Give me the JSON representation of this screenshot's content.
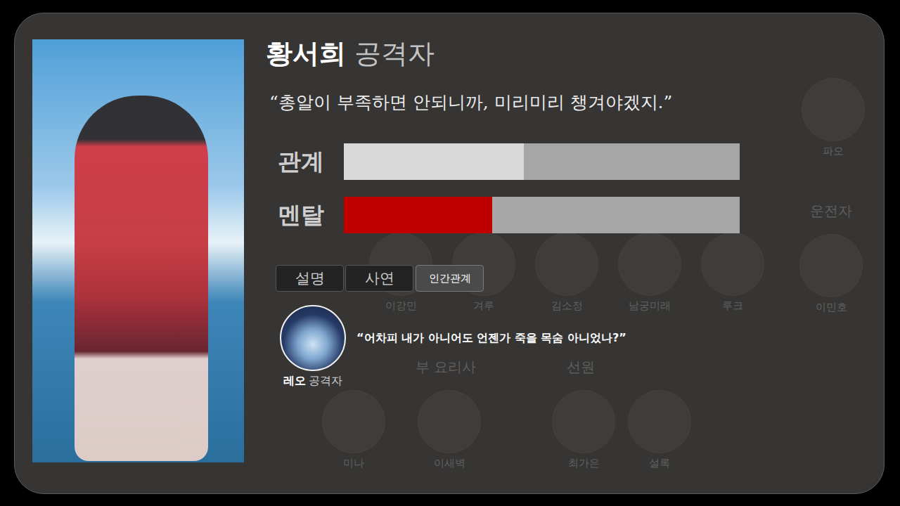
{
  "character": {
    "name": "황서희",
    "role": "공격자",
    "quote": "“총알이 부족하면 안되니까, 미리미리 챙겨야겠지.”"
  },
  "stats": [
    {
      "label": "관계",
      "level": 0.455,
      "color": "#d9d9d9"
    },
    {
      "label": "멘탈",
      "level": 0.375,
      "color": "#c00000"
    }
  ],
  "tabs": [
    {
      "label": "설명",
      "selected": false
    },
    {
      "label": "사연",
      "selected": false
    },
    {
      "label": "인간관계",
      "selected": true
    }
  ],
  "relations": [
    {
      "name": "레오",
      "role": "공격자",
      "quote": "“어차피 내가 아니어도 언젠가 죽을 목숨 아니었나?”"
    }
  ],
  "roster": [
    {
      "members": [
        "파오"
      ]
    },
    {
      "header": "운전자",
      "members": [
        "이민호"
      ]
    },
    {
      "members": [
        "이강민",
        "겨루",
        "김소정",
        "남궁미래",
        "루크"
      ]
    },
    {
      "header": "부 요리사",
      "members": [
        "미나",
        "이새벽"
      ]
    },
    {
      "header": "선원",
      "members": [
        "최가은",
        "설록"
      ]
    }
  ]
}
